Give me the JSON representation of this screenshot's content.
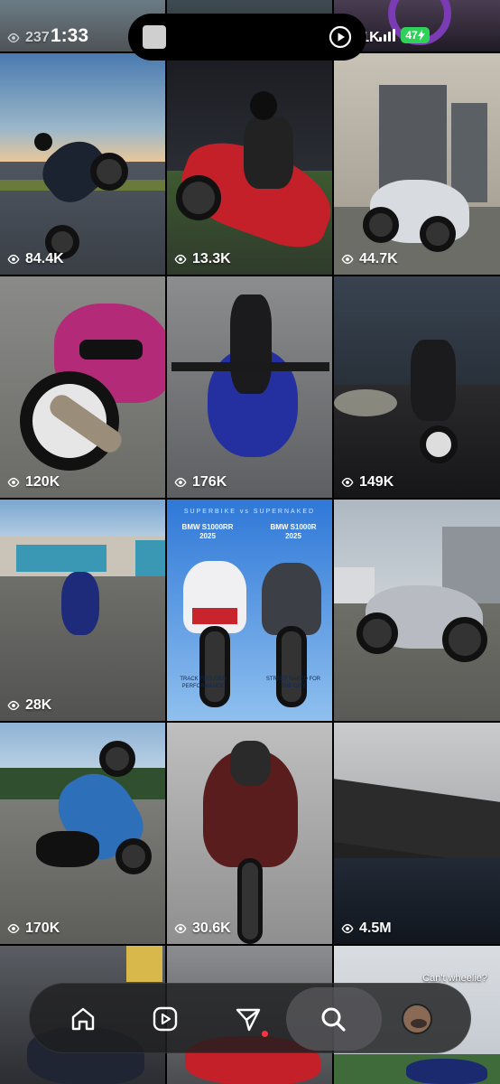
{
  "status_bar": {
    "time": "1:33",
    "battery": "47"
  },
  "tiles": [
    {
      "views": "237"
    },
    {
      "views": ""
    },
    {
      "views": "72.1K"
    },
    {
      "views": "84.4K"
    },
    {
      "views": "13.3K"
    },
    {
      "views": "44.7K"
    },
    {
      "views": "120K"
    },
    {
      "views": "176K"
    },
    {
      "views": "149K"
    },
    {
      "views": "28K"
    },
    {
      "views": ""
    },
    {
      "views": ""
    },
    {
      "views": "170K"
    },
    {
      "views": "30.6K"
    },
    {
      "views": "4.5M"
    },
    {
      "views": ""
    },
    {
      "views": ""
    },
    {
      "views": ""
    }
  ],
  "poster": {
    "heading": "SUPERBIKE vs SUPERNAKED",
    "left_model": "BMW S1000RR 2025",
    "right_model": "BMW S1000R 2025",
    "left_note": "TRACK FOCUSED PERFORMANCE",
    "right_note": "STREET NAKED FOR THE CITY"
  },
  "tile_caption_wheelie": "Can't wheelie?",
  "nav": {
    "items": [
      "home-icon",
      "reels-icon",
      "messages-icon",
      "search-icon",
      "profile-icon"
    ],
    "active": "search-icon"
  },
  "colors": {
    "background": "#000000",
    "battery": "#30d158",
    "notification": "#ff3040",
    "navbar": "#1e1e20"
  }
}
